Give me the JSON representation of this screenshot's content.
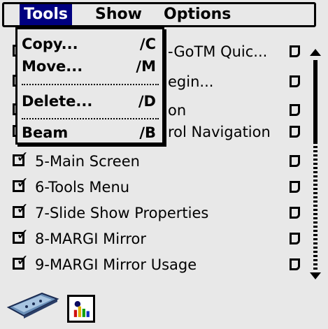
{
  "menubar": {
    "items": [
      {
        "label": "Tools"
      },
      {
        "label": "Show"
      },
      {
        "label": "Options"
      }
    ]
  },
  "dropdown": {
    "items": [
      {
        "label": "Copy...",
        "shortcut": "∕C"
      },
      {
        "label": "Move...",
        "shortcut": "∕M"
      },
      {
        "label": "Delete...",
        "shortcut": "∕D"
      },
      {
        "label": "Beam",
        "shortcut": "∕B"
      }
    ]
  },
  "list": {
    "hidden_rows": [
      {
        "label": "-GoTM Quic..."
      },
      {
        "label": "egin..."
      },
      {
        "label": "on"
      },
      {
        "label": "rol Navigation"
      }
    ],
    "rows": [
      {
        "label": "5-Main Screen"
      },
      {
        "label": "6-Tools Menu"
      },
      {
        "label": "7-Slide Show Properties"
      },
      {
        "label": "8-MARGI Mirror"
      },
      {
        "label": "9-MARGI Mirror Usage"
      }
    ],
    "check_glyph": "✓"
  },
  "colors": {
    "menu_highlight": "#000080",
    "background": "#e8e8e8"
  }
}
